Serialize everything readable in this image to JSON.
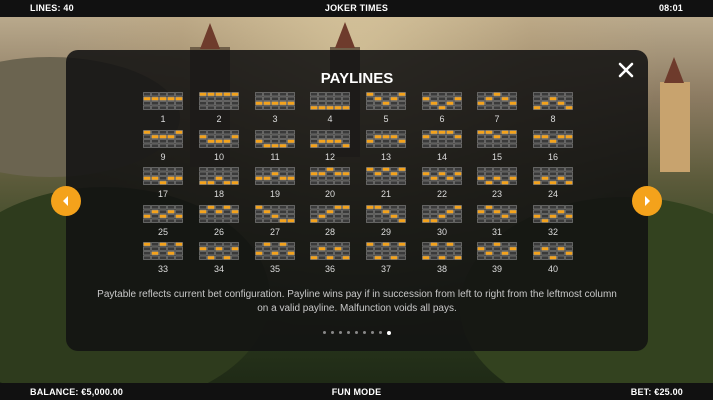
{
  "topbar": {
    "lines": "LINES: 40",
    "title": "JOKER TIMES",
    "time": "08:01"
  },
  "bottombar": {
    "balance": "BALANCE: €5,000.00",
    "mode": "FUN MODE",
    "bet": "BET: €25.00"
  },
  "panel": {
    "title": "PAYLINES",
    "description": "Paytable reflects current bet configuration.  Payline wins pay if in succession from left to right from the leftmost column on a valid payline.  Malfunction voids all pays.",
    "page_count": 9,
    "active_page": 9
  },
  "colors": {
    "accent": "#f4a21b",
    "cell_off": "#3a3a3a",
    "cell_border": "#8a8a8a"
  },
  "icons": {
    "close": "close-icon",
    "prev": "chevron-left-icon",
    "next": "chevron-right-icon"
  },
  "paylines": [
    {
      "number": "1",
      "rows": [
        1,
        1,
        1,
        1,
        1
      ]
    },
    {
      "number": "2",
      "rows": [
        0,
        0,
        0,
        0,
        0
      ]
    },
    {
      "number": "3",
      "rows": [
        2,
        2,
        2,
        2,
        2
      ]
    },
    {
      "number": "4",
      "rows": [
        3,
        3,
        3,
        3,
        3
      ]
    },
    {
      "number": "5",
      "rows": [
        0,
        1,
        2,
        1,
        0
      ]
    },
    {
      "number": "6",
      "rows": [
        1,
        2,
        3,
        2,
        1
      ]
    },
    {
      "number": "7",
      "rows": [
        2,
        1,
        0,
        1,
        2
      ]
    },
    {
      "number": "8",
      "rows": [
        3,
        2,
        1,
        2,
        3
      ]
    },
    {
      "number": "9",
      "rows": [
        0,
        1,
        1,
        1,
        0
      ]
    },
    {
      "number": "10",
      "rows": [
        1,
        2,
        2,
        2,
        1
      ]
    },
    {
      "number": "11",
      "rows": [
        2,
        3,
        3,
        3,
        2
      ]
    },
    {
      "number": "12",
      "rows": [
        3,
        2,
        2,
        2,
        3
      ]
    },
    {
      "number": "13",
      "rows": [
        2,
        1,
        1,
        1,
        2
      ]
    },
    {
      "number": "14",
      "rows": [
        1,
        0,
        0,
        0,
        1
      ]
    },
    {
      "number": "15",
      "rows": [
        0,
        0,
        1,
        0,
        0
      ]
    },
    {
      "number": "16",
      "rows": [
        1,
        1,
        2,
        1,
        1
      ]
    },
    {
      "number": "17",
      "rows": [
        2,
        2,
        3,
        2,
        2
      ]
    },
    {
      "number": "18",
      "rows": [
        3,
        3,
        2,
        3,
        3
      ]
    },
    {
      "number": "19",
      "rows": [
        2,
        2,
        1,
        2,
        2
      ]
    },
    {
      "number": "20",
      "rows": [
        1,
        1,
        0,
        1,
        1
      ]
    },
    {
      "number": "21",
      "rows": [
        0,
        1,
        0,
        1,
        0
      ]
    },
    {
      "number": "22",
      "rows": [
        1,
        2,
        1,
        2,
        1
      ]
    },
    {
      "number": "23",
      "rows": [
        2,
        3,
        2,
        3,
        2
      ]
    },
    {
      "number": "24",
      "rows": [
        3,
        2,
        3,
        2,
        3
      ]
    },
    {
      "number": "25",
      "rows": [
        2,
        1,
        2,
        1,
        2
      ]
    },
    {
      "number": "26",
      "rows": [
        1,
        0,
        1,
        0,
        1
      ]
    },
    {
      "number": "27",
      "rows": [
        0,
        1,
        2,
        3,
        3
      ]
    },
    {
      "number": "28",
      "rows": [
        3,
        2,
        1,
        0,
        0
      ]
    },
    {
      "number": "29",
      "rows": [
        0,
        0,
        1,
        2,
        3
      ]
    },
    {
      "number": "30",
      "rows": [
        3,
        3,
        2,
        1,
        0
      ]
    },
    {
      "number": "31",
      "rows": [
        1,
        0,
        1,
        2,
        1
      ]
    },
    {
      "number": "32",
      "rows": [
        2,
        3,
        2,
        1,
        2
      ]
    },
    {
      "number": "33",
      "rows": [
        0,
        2,
        0,
        2,
        0
      ]
    },
    {
      "number": "34",
      "rows": [
        1,
        3,
        1,
        3,
        1
      ]
    },
    {
      "number": "35",
      "rows": [
        2,
        0,
        2,
        0,
        2
      ]
    },
    {
      "number": "36",
      "rows": [
        3,
        1,
        3,
        1,
        3
      ]
    },
    {
      "number": "37",
      "rows": [
        0,
        3,
        0,
        3,
        0
      ]
    },
    {
      "number": "38",
      "rows": [
        3,
        0,
        3,
        0,
        3
      ]
    },
    {
      "number": "39",
      "rows": [
        1,
        2,
        0,
        2,
        1
      ]
    },
    {
      "number": "40",
      "rows": [
        2,
        1,
        3,
        1,
        2
      ]
    }
  ]
}
